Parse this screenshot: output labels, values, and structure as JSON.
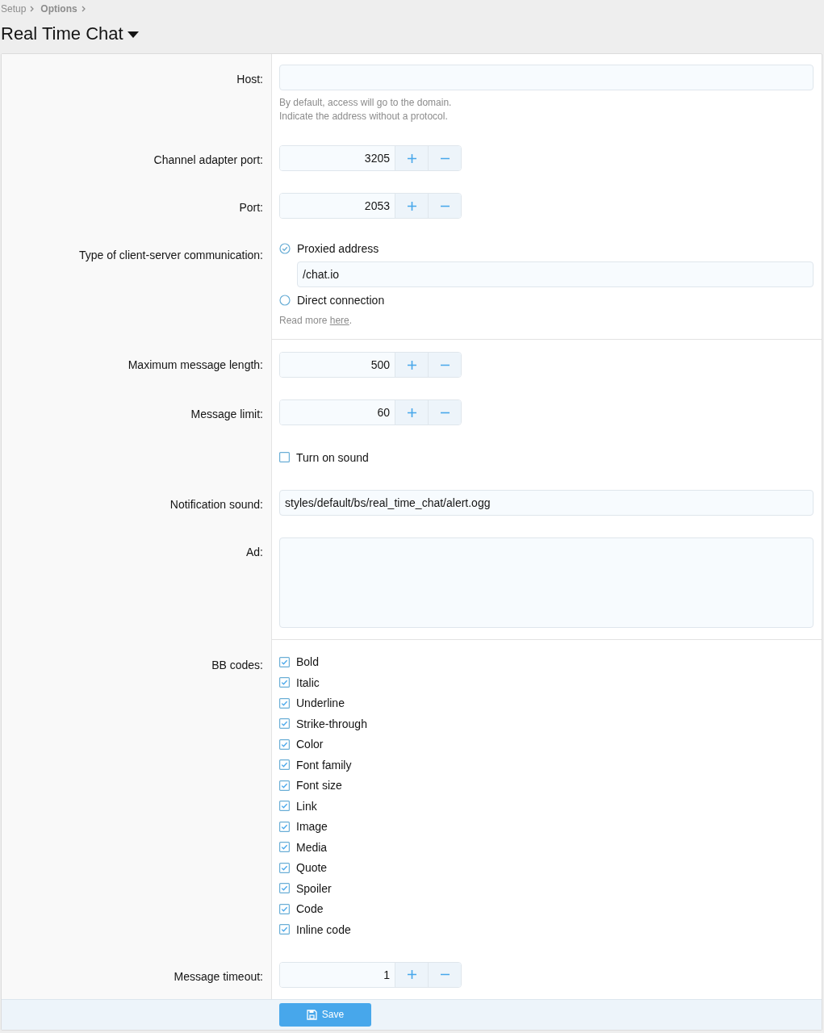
{
  "breadcrumb": [
    {
      "label": "Setup",
      "bold": false
    },
    {
      "label": "Options",
      "bold": true
    }
  ],
  "title": "Real Time Chat",
  "sections": [
    [
      {
        "kind": "text",
        "label": "Host:",
        "hint": "By default, access will go to the domain.\nIndicate the address without a protocol."
      },
      {
        "kind": "number",
        "label": "Channel adapter port:",
        "value": "3205"
      },
      {
        "kind": "number",
        "label": "Port:",
        "value": "2053"
      },
      {
        "kind": "radio",
        "label": "Type of client-server communication:",
        "options": [
          {
            "label": "Proxied address",
            "selected": true,
            "field": "/chat.io"
          },
          {
            "label": "Direct connection",
            "selected": false
          }
        ],
        "note": {
          "text": "Read more ",
          "link": "here",
          "after": "."
        }
      }
    ],
    [
      {
        "kind": "number",
        "label": "Maximum message length:",
        "value": "500"
      },
      {
        "kind": "number",
        "label": "Message limit:",
        "value": "60"
      },
      {
        "kind": "checklist",
        "options": [
          {
            "label": "Turn on sound",
            "checked": false
          }
        ]
      },
      {
        "kind": "text",
        "label": "Notification sound:",
        "value": "styles/default/bs/real_time_chat/alert.ogg"
      },
      {
        "kind": "textarea",
        "label": "Ad:"
      }
    ],
    [
      {
        "kind": "checklist",
        "label": "BB codes:",
        "options": [
          {
            "label": "Bold",
            "checked": true
          },
          {
            "label": "Italic",
            "checked": true
          },
          {
            "label": "Underline",
            "checked": true
          },
          {
            "label": "Strike-through",
            "checked": true
          },
          {
            "label": "Color",
            "checked": true
          },
          {
            "label": "Font family",
            "checked": true
          },
          {
            "label": "Font size",
            "checked": true
          },
          {
            "label": "Link",
            "checked": true
          },
          {
            "label": "Image",
            "checked": true
          },
          {
            "label": "Media",
            "checked": true
          },
          {
            "label": "Quote",
            "checked": true
          },
          {
            "label": "Spoiler",
            "checked": true
          },
          {
            "label": "Code",
            "checked": true
          },
          {
            "label": "Inline code",
            "checked": true
          }
        ]
      },
      {
        "kind": "number",
        "label": "Message timeout:",
        "value": "1"
      }
    ]
  ],
  "save_button": {
    "label": "Save"
  }
}
